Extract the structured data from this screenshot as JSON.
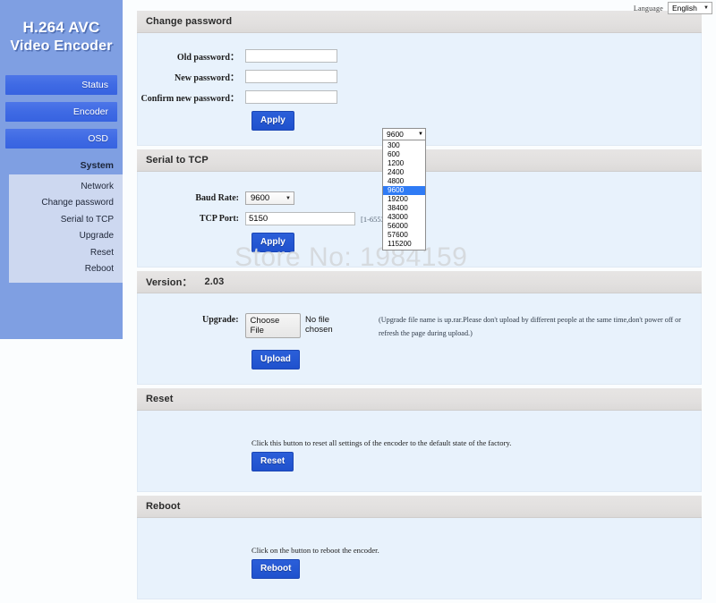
{
  "topbar": {
    "language_label": "Language",
    "language_value": "English"
  },
  "sidebar": {
    "logo_line1": "H.264 AVC",
    "logo_line2": "Video Encoder",
    "main_items": [
      {
        "label": "Status"
      },
      {
        "label": "Encoder"
      },
      {
        "label": "OSD"
      }
    ],
    "system_label": "System",
    "sub_items": [
      {
        "label": "Network"
      },
      {
        "label": "Change password"
      },
      {
        "label": "Serial to TCP"
      },
      {
        "label": "Upgrade"
      },
      {
        "label": "Reset"
      },
      {
        "label": "Reboot"
      }
    ]
  },
  "change_password": {
    "title": "Change password",
    "old_label": "Old password：",
    "new_label": "New password：",
    "confirm_label": "Confirm new password：",
    "old_value": "",
    "new_value": "",
    "confirm_value": "",
    "apply_label": "Apply"
  },
  "serial_to_tcp": {
    "title": "Serial to TCP",
    "baud_label": "Baud Rate:",
    "baud_value": "9600",
    "port_label": "TCP Port:",
    "port_value": "5150",
    "port_hint": "[1-65535]",
    "apply_label": "Apply"
  },
  "baud_dropdown": {
    "selected": "9600",
    "options": [
      "300",
      "600",
      "1200",
      "2400",
      "4800",
      "9600",
      "19200",
      "38400",
      "43000",
      "56000",
      "57600",
      "115200"
    ]
  },
  "version": {
    "title": "Version：",
    "number": "2.03",
    "upgrade_label": "Upgrade:",
    "choose_file_label": "Choose File",
    "no_file_label": "No file chosen",
    "note_line1": "(Upgrade file name is up.rar.Please don't upload by different people at the same time,don't power off or",
    "note_line2": "refresh the page during upload.)",
    "upload_label": "Upload"
  },
  "reset": {
    "title": "Reset",
    "description": "Click this button to reset all settings of the encoder to the default state of the factory.",
    "button_label": "Reset"
  },
  "reboot": {
    "title": "Reboot",
    "description": "Click on the button to reboot the encoder.",
    "button_label": "Reboot"
  },
  "watermark": {
    "text": "Store No: 1984159"
  },
  "colors": {
    "sidebar_blue": "#7f9fe2",
    "nav_active_blue": "#3f6ae4",
    "panel_header_gray": "#e2e0df",
    "panel_body_blue": "#e8f2fc",
    "button_blue": "#1f51cd",
    "dropdown_highlight": "#2f7bf5"
  }
}
